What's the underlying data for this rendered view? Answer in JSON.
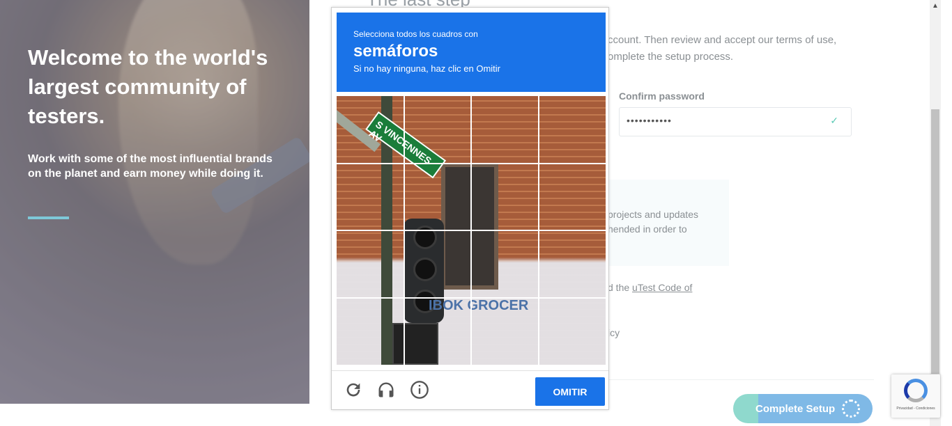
{
  "hero": {
    "title": "Welcome to the world's largest community of testers.",
    "subtitle": "Work with some of the most influential brands on the planet and earn money while doing it."
  },
  "form": {
    "step_title": "The last step",
    "intro": "ccount. Then review and accept our terms of use, omplete the setup process.",
    "confirm_label": "Confirm password",
    "confirm_value": "•••••••••••",
    "info_text_1": "projects and updates",
    "info_text_2": "hended in order to",
    "code_prefix": "d the ",
    "code_link": "uTest Code of",
    "policy_text": "icy",
    "complete_button": "Complete Setup"
  },
  "captcha": {
    "instruction": "Selecciona todos los cuadros con",
    "keyword": "semáforos",
    "hint": "Si no hay ninguna, haz clic en Omitir",
    "skip_button": "OMITIR",
    "sign_text": "S VINCENNES AV",
    "store_text": "IBOK GROCER",
    "tile_count": 16
  },
  "badge": {
    "terms": "Privacidad - Condiciones"
  },
  "colors": {
    "captcha_blue": "#1a73e8",
    "accent_teal": "#7ec8d8",
    "complete_btn": "#7fb9e6"
  }
}
